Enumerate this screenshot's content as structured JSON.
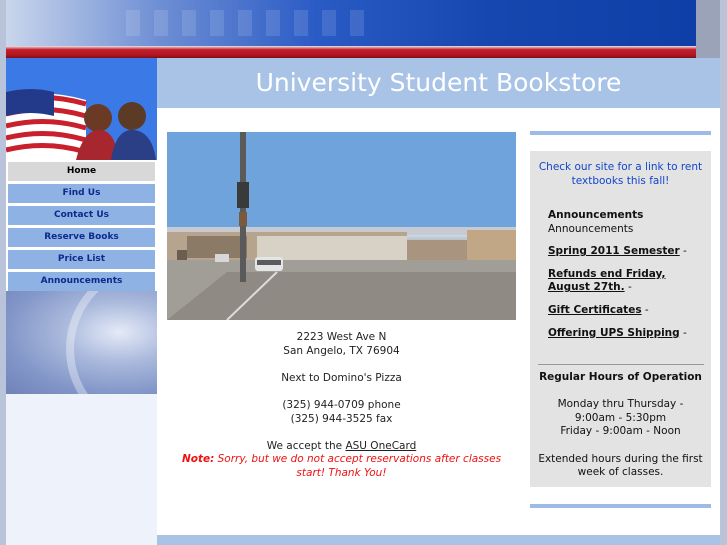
{
  "header": {
    "title": "University Student Bookstore"
  },
  "nav": {
    "items": [
      {
        "label": "Home",
        "active": true
      },
      {
        "label": "Find Us",
        "active": false
      },
      {
        "label": "Contact Us",
        "active": false
      },
      {
        "label": "Reserve Books",
        "active": false
      },
      {
        "label": "Price List",
        "active": false
      },
      {
        "label": "Announcements",
        "active": false
      }
    ]
  },
  "main": {
    "address_line1": "2223 West Ave N",
    "address_line2": "San Angelo, TX 76904",
    "landmark": "Next to Domino's Pizza",
    "phone": "(325) 944-0709 phone",
    "fax": "(325) 944-3525 fax",
    "accept_prefix": "We accept the ",
    "accept_link": "ASU OneCard",
    "note_label": "Note:",
    "note_text": " Sorry, but we do not accept reservations after classes start! Thank You!"
  },
  "sidebar_right": {
    "promo": "Check our site for a link to rent textbooks this fall!",
    "announcements_heading": "Announcements",
    "announcements_sub": "Announcements",
    "items": [
      {
        "link": "Spring 2011 Semester",
        "suffix": " -"
      },
      {
        "link": "Refunds end Friday, August 27th.",
        "suffix": " -"
      },
      {
        "link": "Gift Certificates",
        "suffix": " -"
      },
      {
        "link": "Offering UPS Shipping",
        "suffix": " -"
      }
    ],
    "hours_title": "Regular Hours of Operation",
    "hours_line1": "Monday thru Thursday -",
    "hours_line2": "9:00am - 5:30pm",
    "hours_line3": "Friday - 9:00am - Noon",
    "hours_extended": "Extended hours during the first week of classes."
  },
  "colors": {
    "accent_blue": "#a9c3e7",
    "nav_blue": "#8fb2e4",
    "banner_red": "#c41e2a",
    "note_red": "#ee1111",
    "promo_blue": "#1245c9"
  }
}
